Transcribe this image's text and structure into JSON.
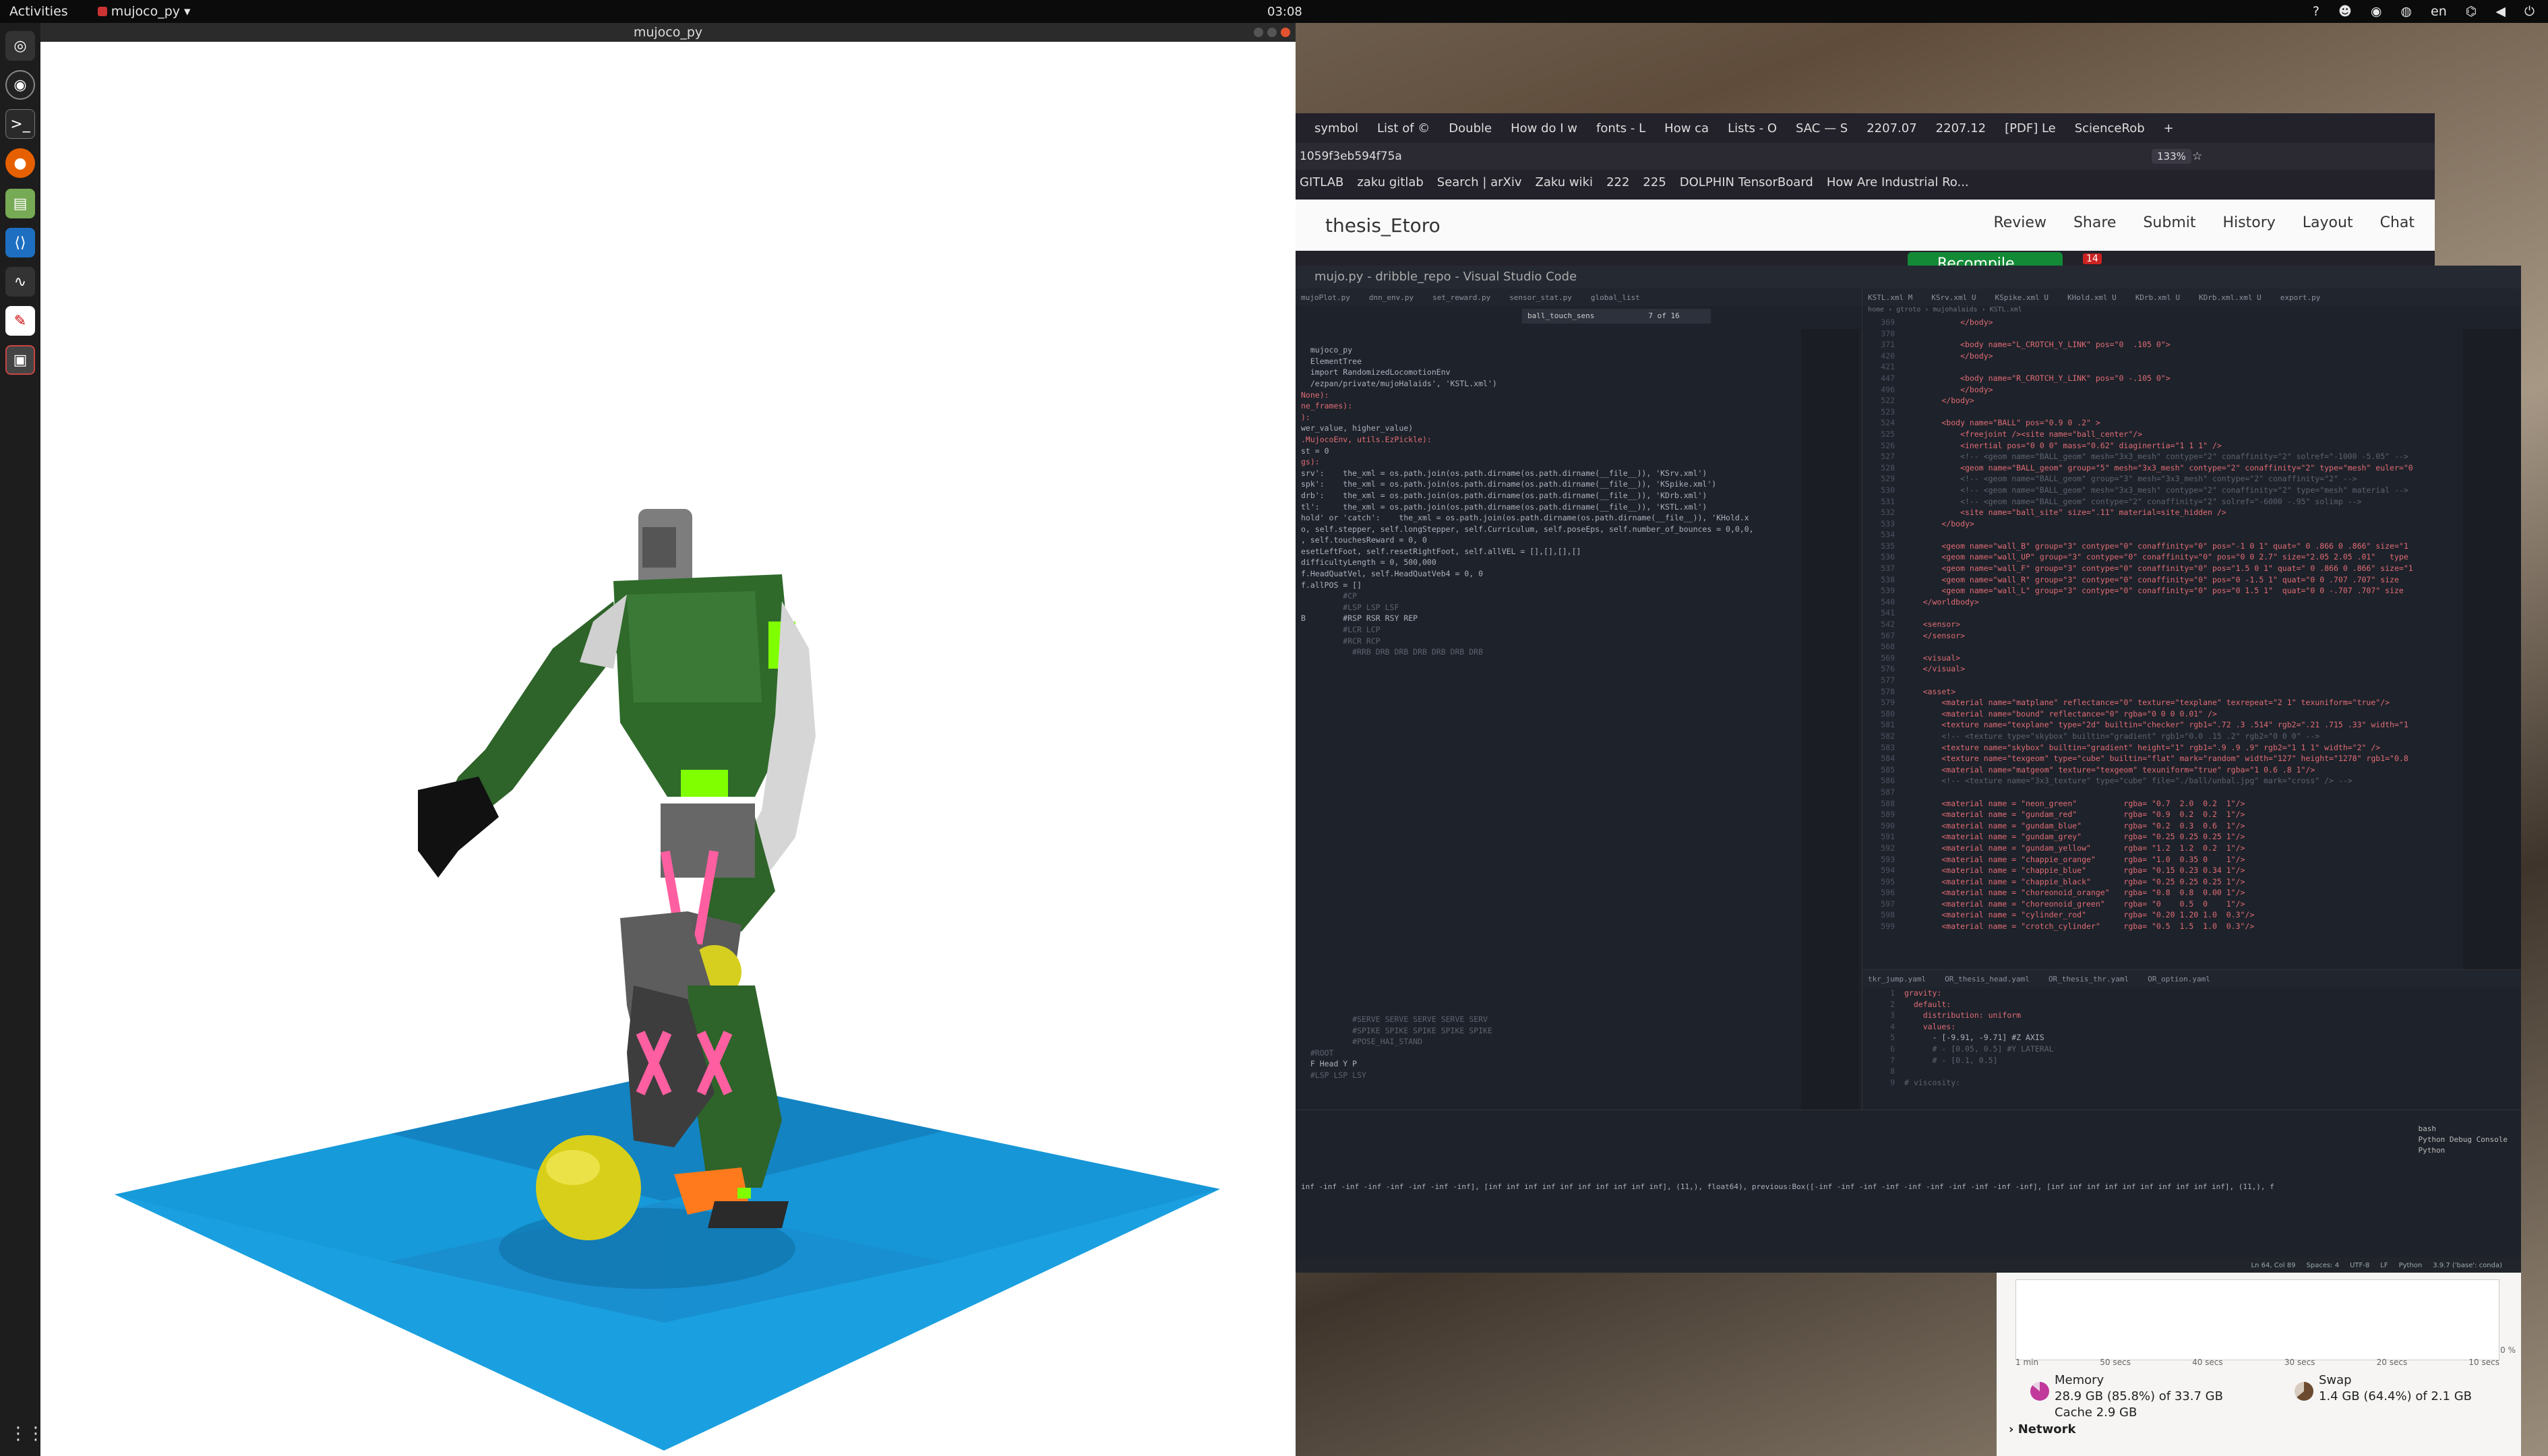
{
  "topbar": {
    "activities": "Activities",
    "app": "mujoco_py",
    "clock": "03:08",
    "lang": "en"
  },
  "mujoco": {
    "title": "mujoco_py"
  },
  "firefox": {
    "tabs": [
      "symbol",
      "List of ©",
      "Double",
      "How do I w",
      "fonts - L",
      "How ca",
      "Lists - O",
      "SAC — S",
      "2207.07",
      "2207.12",
      "[PDF] Le",
      "ScienceRob"
    ],
    "url": "1059f3eb594f75a",
    "zoom": "133%",
    "bookmarks": [
      "GITLAB",
      "zaku gitlab",
      "Search | arXiv",
      "Zaku wiki",
      "222",
      "225",
      "DOLPHIN TensorBoard",
      "How Are Industrial Ro..."
    ],
    "project": "thesis_Etoro",
    "buttons": [
      "Review",
      "Share",
      "Submit",
      "History",
      "Layout",
      "Chat"
    ],
    "recompile": "Recompile",
    "badge": "14"
  },
  "vscode": {
    "title": "mujo.py - dribble_repo - Visual Studio Code",
    "left_tabs": [
      "mujoPlot.py",
      "dnn_env.py",
      "set_reward.py",
      "sensor_stat.py",
      "global_list"
    ],
    "right_tabs": [
      "KSTL.xml M",
      "KSrv.xml U",
      "KSpike.xml U",
      "KHold.xml U",
      "KDrb.xml U",
      "KDrb.xml.xml U",
      "export.py"
    ],
    "find": {
      "query": "ball_touch_sens",
      "count": "7 of 16"
    },
    "right_code": [
      {
        "n": "369",
        "t": "            </body>"
      },
      {
        "n": "370",
        "t": ""
      },
      {
        "n": "371",
        "t": "            <body name=\"L_CROTCH_Y_LINK\" pos=\"0  .105 0\">"
      },
      {
        "n": "420",
        "t": "            </body>"
      },
      {
        "n": "421",
        "t": ""
      },
      {
        "n": "447",
        "t": "            <body name=\"R_CROTCH_Y_LINK\" pos=\"0 -.105 0\">"
      },
      {
        "n": "496",
        "t": "            </body>"
      },
      {
        "n": "522",
        "t": "        </body>"
      },
      {
        "n": "523",
        "t": ""
      },
      {
        "n": "524",
        "t": "        <body name=\"BALL\" pos=\"0.9 0 .2\" >"
      },
      {
        "n": "525",
        "t": "            <freejoint /><site name=\"ball_center\"/>"
      },
      {
        "n": "526",
        "t": "            <inertial pos=\"0 0 0\" mass=\"0.62\" diaginertia=\"1 1 1\" />"
      },
      {
        "n": "527",
        "t": "            <!-- <geom name=\"BALL_geom\" mesh=\"3x3_mesh\" contype=\"2\" conaffinity=\"2\" solref=\"-1000 -5.05\" -->"
      },
      {
        "n": "528",
        "t": "            <geom name=\"BALL_geom\" group=\"5\" mesh=\"3x3_mesh\" contype=\"2\" conaffinity=\"2\" type=\"mesh\" euler=\"0"
      },
      {
        "n": "529",
        "t": "            <!-- <geom name=\"BALL_geom\" group=\"3\" mesh=\"3x3_mesh\" contype=\"2\" conaffinity=\"2\" -->"
      },
      {
        "n": "530",
        "t": "            <!-- <geom name=\"BALL_geom\" mesh=\"3x3_mesh\" contype=\"2\" conaffinity=\"2\" type=\"mesh\" material -->"
      },
      {
        "n": "531",
        "t": "            <!-- <geom name=\"BALL_geom\" contype=\"2\" conaffinity=\"2\" solref=\"-6000 -.95\" solimp -->"
      },
      {
        "n": "532",
        "t": "            <site name=\"ball_site\" size=\".11\" material=site_hidden />"
      },
      {
        "n": "533",
        "t": "        </body>"
      },
      {
        "n": "534",
        "t": ""
      },
      {
        "n": "535",
        "t": "        <geom name=\"wall_B\" group=\"3\" contype=\"0\" conaffinity=\"0\" pos=\"-1 0 1\" quat=\" 0 .866 0 .866\" size=\"1"
      },
      {
        "n": "536",
        "t": "        <geom name=\"wall_UP\" group=\"3\" contype=\"0\" conaffinity=\"0\" pos=\"0 0 2.7\" size=\"2.05 2.05 .01\"   type"
      },
      {
        "n": "537",
        "t": "        <geom name=\"wall_F\" group=\"3\" contype=\"0\" conaffinity=\"0\" pos=\"1.5 0 1\" quat=\" 0 .866 0 .866\" size=\"1"
      },
      {
        "n": "538",
        "t": "        <geom name=\"wall_R\" group=\"3\" contype=\"0\" conaffinity=\"0\" pos=\"0 -1.5 1\" quat=\"0 0 .707 .707\" size"
      },
      {
        "n": "539",
        "t": "        <geom name=\"wall_L\" group=\"3\" contype=\"0\" conaffinity=\"0\" pos=\"0 1.5 1\"  quat=\"0 0 -.707 .707\" size"
      },
      {
        "n": "540",
        "t": "    </worldbody>"
      },
      {
        "n": "541",
        "t": ""
      },
      {
        "n": "542",
        "t": "    <sensor>"
      },
      {
        "n": "567",
        "t": "    </sensor>"
      },
      {
        "n": "568",
        "t": ""
      },
      {
        "n": "569",
        "t": "    <visual>"
      },
      {
        "n": "576",
        "t": "    </visual>"
      },
      {
        "n": "577",
        "t": ""
      },
      {
        "n": "578",
        "t": "    <asset>"
      },
      {
        "n": "579",
        "t": "        <material name=\"matplane\" reflectance=\"0\" texture=\"texplane\" texrepeat=\"2 1\" texuniform=\"true\"/>"
      },
      {
        "n": "580",
        "t": "        <material name=\"bound\" reflectance=\"0\" rgba=\"0 0 0 0.01\" />"
      },
      {
        "n": "581",
        "t": "        <texture name=\"texplane\" type=\"2d\" builtin=\"checker\" rgb1=\".72 .3 .514\" rgb2=\".21 .715 .33\" width=\"1"
      },
      {
        "n": "582",
        "t": "        <!-- <texture type=\"skybox\" builtin=\"gradient\" rgb1=\"0.0 .15 .2\" rgb2=\"0 0 0\" -->"
      },
      {
        "n": "583",
        "t": "        <texture name=\"skybox\" builtin=\"gradient\" height=\"1\" rgb1=\".9 .9 .9\" rgb2=\"1 1 1\" width=\"2\" />"
      },
      {
        "n": "584",
        "t": "        <texture name=\"texgeom\" type=\"cube\" builtin=\"flat\" mark=\"random\" width=\"127\" height=\"1278\" rgb1=\"0.8"
      },
      {
        "n": "585",
        "t": "        <material name=\"matgeom\" texture=\"texgeom\" texuniform=\"true\" rgba=\"1 0.6 .8 1\"/>"
      },
      {
        "n": "586",
        "t": "        <!-- <texture name=\"3x3_texture\" type=\"cube\" file=\"./ball/unbal.jpg\" mark=\"cross\" /> -->"
      },
      {
        "n": "587",
        "t": ""
      },
      {
        "n": "588",
        "t": "        <material name = \"neon_green\"          rgba= \"0.7  2.0  0.2  1\"/>"
      },
      {
        "n": "589",
        "t": "        <material name = \"gundam_red\"          rgba= \"0.9  0.2  0.2  1\"/>"
      },
      {
        "n": "590",
        "t": "        <material name = \"gundam_blue\"         rgba= \"0.2  0.3  0.6  1\"/>"
      },
      {
        "n": "591",
        "t": "        <material name = \"gundam_grey\"         rgba= \"0.25 0.25 0.25 1\"/>"
      },
      {
        "n": "592",
        "t": "        <material name = \"gundam_yellow\"       rgba= \"1.2  1.2  0.2  1\"/>"
      },
      {
        "n": "593",
        "t": "        <material name = \"chappie_orange\"      rgba= \"1.0  0.35 0    1\"/>"
      },
      {
        "n": "594",
        "t": "        <material name = \"chappie_blue\"        rgba= \"0.15 0.23 0.34 1\"/>"
      },
      {
        "n": "595",
        "t": "        <material name = \"chappie_black\"       rgba= \"0.25 0.25 0.25 1\"/>"
      },
      {
        "n": "596",
        "t": "        <material name = \"choreonoid_orange\"   rgba= \"0.8  0.8  0.00 1\"/>"
      },
      {
        "n": "597",
        "t": "        <material name = \"choreonoid_green\"    rgba= \"0    0.5  0    1\"/>"
      },
      {
        "n": "598",
        "t": "        <material name = \"cylinder_rod\"        rgba= \"0.20 1.20 1.0  0.3\"/>"
      },
      {
        "n": "599",
        "t": "        <material name = \"crotch_cylinder\"     rgba= \"0.5  1.5  1.0  0.3\"/>"
      }
    ],
    "left_code": [
      "",
      "                                                       ",
      "                                                       ",
      "",
      "",
      "  mujoco_py",
      "  ElementTree",
      "  import RandomizedLocomotionEnv",
      "  /ezpan/private/mujoHalaids', 'KSTL.xml')",
      "",
      "",
      "None):",
      "ne_frames):",
      "",
      "):",
      "",
      "",
      "",
      "wer_value, higher_value)",
      "",
      ".MujocoEnv, utils.EzPickle):",
      "st = 0",
      "",
      "gs):",
      "",
      "",
      "",
      "srv':    the_xml = os.path.join(os.path.dirname(os.path.dirname(__file__)), 'KSrv.xml')",
      "spk':    the_xml = os.path.join(os.path.dirname(os.path.dirname(__file__)), 'KSpike.xml')",
      "drb':    the_xml = os.path.join(os.path.dirname(os.path.dirname(__file__)), 'KDrb.xml')",
      "tl':     the_xml = os.path.join(os.path.dirname(os.path.dirname(__file__)), 'KSTL.xml')",
      "hold' or 'catch':    the_xml = os.path.join(os.path.dirname(os.path.dirname(__file__)), 'KHold.x",
      "",
      "o, self.stepper, self.longStepper, self.Curriculum, self.poseEps, self.number_of_bounces = 0,0,0,",
      ", self.touchesReward = 0, 0",
      "esetLeftFoot, self.resetRightFoot, self.allVEL = [],[],[],[]",
      "difficultyLength = 0, 500,000",
      "f.HeadQuatVel, self.HeadQuatVeb4 = 0, 0",
      "f.allPOS = []",
      "",
      "         #CP",
      "         #LSP LSP LSF",
      "B        #RSP RSR RSY REP",
      "         #LCR LCP",
      "",
      "         #RCR RCP",
      "",
      "",
      "",
      "",
      "           #RRB DRB DRB DRB DRB DRB DRB"
    ],
    "left_code_bottom": [
      "           #SERVE SERVE SERVE SERVE SERV",
      "           #SPIKE SPIKE SPIKE SPIKE SPIKE",
      "",
      "           #POSE_HAI_STAND",
      "  #ROOT",
      "  F Head Y P",
      "",
      "  #LSP LSP LSY"
    ],
    "yaml_tabs": [
      "tkr_jump.yaml",
      "OR_thesis_head.yaml",
      "OR_thesis_thr.yaml",
      "OR_option.yaml"
    ],
    "yaml_code": [
      {
        "n": "1",
        "t": "gravity:"
      },
      {
        "n": "2",
        "t": "  default:"
      },
      {
        "n": "3",
        "t": "    distribution: uniform"
      },
      {
        "n": "4",
        "t": "    values:"
      },
      {
        "n": "5",
        "t": "      - [-9.91, -9.71] #Z AXIS"
      },
      {
        "n": "6",
        "t": "      # - [0.05, 0.5] #Y LATERAL"
      },
      {
        "n": "7",
        "t": "      # - [0.1, 0.5]"
      },
      {
        "n": "8",
        "t": ""
      },
      {
        "n": "9",
        "t": "# viscosity:"
      }
    ],
    "terminal_line": "inf -inf -inf -inf -inf -inf -inf -inf], [inf inf inf inf inf inf inf inf inf inf], (11,), float64), previous:Box([-inf -inf -inf -inf -inf -inf -inf -inf -inf -inf], [inf inf inf inf inf inf inf inf inf inf], (11,), f",
    "terminal_panels": [
      "bash",
      "Python Debug Console",
      "Python"
    ],
    "status": [
      "Ln 64, Col 89",
      "Spaces: 4",
      "UTF-8",
      "LF",
      "Python",
      "3.9.7 ('base': conda)"
    ]
  },
  "sysmon": {
    "ticks": [
      "1 min",
      "50 secs",
      "40 secs",
      "30 secs",
      "20 secs",
      "10 secs"
    ],
    "memory_label": "Memory",
    "memory_value": "28.9 GB (85.8%) of 33.7 GB",
    "cache": "Cache 2.9 GB",
    "swap_label": "Swap",
    "swap_value": "1.4 GB (64.4%) of 2.1 GB",
    "network": "Network",
    "zero": "0 %"
  }
}
